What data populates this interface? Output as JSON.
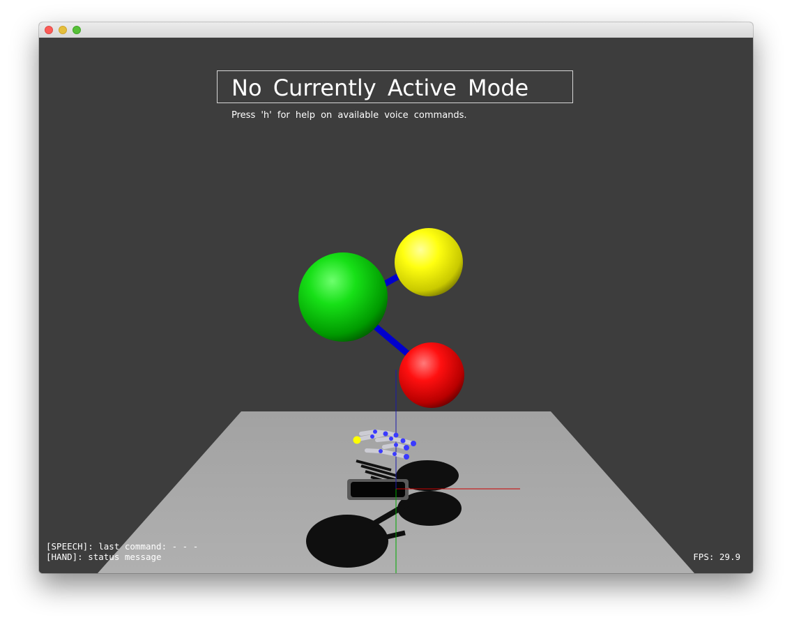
{
  "window": {
    "buttons": [
      "close",
      "minimize",
      "maximize"
    ]
  },
  "overlay": {
    "mode_title": "No Currently Active Mode",
    "help_text": "Press 'h' for help on available voice commands."
  },
  "hud": {
    "speech_line": "[SPEECH]: last command:  - - -",
    "hand_line": "[HAND]: status message",
    "fps_label": "FPS: 29.9"
  },
  "scene": {
    "background_color": "#3d3d3d",
    "floor_color": "#a8a8a8",
    "spheres": [
      {
        "name": "green",
        "color": "#00cc00"
      },
      {
        "name": "yellow",
        "color": "#ffff00"
      },
      {
        "name": "red",
        "color": "#ee0000"
      }
    ],
    "link_color": "#0000cc",
    "axis_colors": {
      "x": "#cc0000",
      "y": "#00aa00",
      "z": "#1a1aaa"
    }
  }
}
